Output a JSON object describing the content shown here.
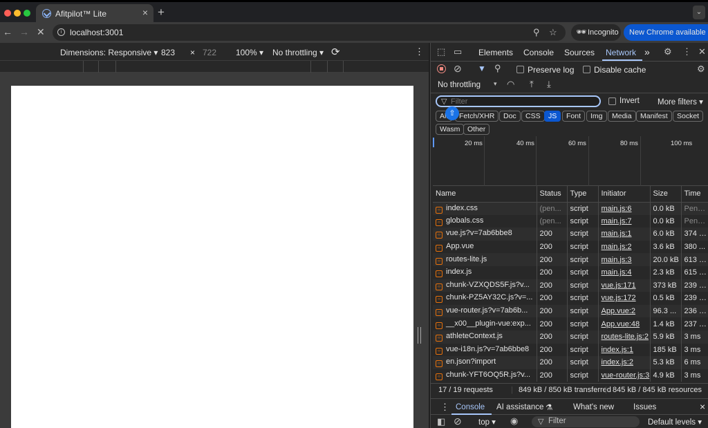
{
  "browser": {
    "tab_title": "Afitpilot™ Lite",
    "tab_close": "×",
    "new_tab": "+",
    "url": "localhost:3001",
    "incognito_label": "Incognito",
    "new_chrome_label": "New Chrome available",
    "traffic_colors": [
      "#ff5f57",
      "#febc2e",
      "#28c840"
    ]
  },
  "device_toolbar": {
    "dimensions_label": "Dimensions: Responsive ▾",
    "width": "823",
    "times": "×",
    "height": "722",
    "zoom": "100% ▾",
    "throttling": "No throttling ▾"
  },
  "devtools": {
    "tabs": [
      "Elements",
      "Console",
      "Sources",
      "Network"
    ],
    "active_tab": "Network",
    "more_tabs": "»",
    "preserve_log": "Preserve log",
    "disable_cache": "Disable cache",
    "throttling": "No throttling",
    "filter_placeholder": "Filter",
    "invert": "Invert",
    "more_filters": "More filters ▾",
    "type_filters": [
      "All",
      "Fetch/XHR",
      "Doc",
      "CSS",
      "JS",
      "Font",
      "Img",
      "Media",
      "Manifest",
      "Socket",
      "Wasm",
      "Other"
    ],
    "active_filter": "JS",
    "timeline_ticks": [
      "20 ms",
      "40 ms",
      "60 ms",
      "80 ms",
      "100 ms"
    ],
    "columns": [
      "Name",
      "Status",
      "Type",
      "Initiator",
      "Size",
      "Time"
    ],
    "requests": [
      {
        "name": "index.css",
        "status": "(pen...",
        "type": "script",
        "initiator": "main.js:6",
        "size": "0.0 kB",
        "time": "Pendi..."
      },
      {
        "name": "globals.css",
        "status": "(pen...",
        "type": "script",
        "initiator": "main.js:7",
        "size": "0.0 kB",
        "time": "Pendi..."
      },
      {
        "name": "vue.js?v=7ab6bbe8",
        "status": "200",
        "type": "script",
        "initiator": "main.js:1",
        "size": "6.0 kB",
        "time": "374 ms"
      },
      {
        "name": "App.vue",
        "status": "200",
        "type": "script",
        "initiator": "main.js:2",
        "size": "3.6 kB",
        "time": "380 ..."
      },
      {
        "name": "routes-lite.js",
        "status": "200",
        "type": "script",
        "initiator": "main.js:3",
        "size": "20.0 kB",
        "time": "613 ms"
      },
      {
        "name": "index.js",
        "status": "200",
        "type": "script",
        "initiator": "main.js:4",
        "size": "2.3 kB",
        "time": "615 ms"
      },
      {
        "name": "chunk-VZXQDS5F.js?v...",
        "status": "200",
        "type": "script",
        "initiator": "vue.js:171",
        "size": "373 kB",
        "time": "239 ms"
      },
      {
        "name": "chunk-PZ5AY32C.js?v=...",
        "status": "200",
        "type": "script",
        "initiator": "vue.js:172",
        "size": "0.5 kB",
        "time": "239 ms"
      },
      {
        "name": "vue-router.js?v=7ab6b...",
        "status": "200",
        "type": "script",
        "initiator": "App.vue:2",
        "size": "96.3 ...",
        "time": "236 ms"
      },
      {
        "name": "__x00__plugin-vue:exp...",
        "status": "200",
        "type": "script",
        "initiator": "App.vue:48",
        "size": "1.4 kB",
        "time": "237 ms"
      },
      {
        "name": "athleteContext.js",
        "status": "200",
        "type": "script",
        "initiator": "routes-lite.js:2",
        "size": "5.9 kB",
        "time": "3 ms"
      },
      {
        "name": "vue-i18n.js?v=7ab6bbe8",
        "status": "200",
        "type": "script",
        "initiator": "index.js:1",
        "size": "185 kB",
        "time": "3 ms"
      },
      {
        "name": "en.json?import",
        "status": "200",
        "type": "script",
        "initiator": "index.js:2",
        "size": "5.3 kB",
        "time": "6 ms"
      },
      {
        "name": "chunk-YFT6OQ5R.js?v...",
        "status": "200",
        "type": "script",
        "initiator": "vue-router.js:3",
        "size": "4.9 kB",
        "time": "3 ms"
      }
    ],
    "summary": {
      "requests": "17 / 19 requests",
      "transferred": "849 kB / 850 kB transferred",
      "resources": "845 kB / 845 kB resources"
    },
    "drawer_tabs": [
      "Console",
      "AI assistance",
      "What's new",
      "Issues"
    ],
    "drawer_close": "×",
    "drawer_context": "top ▾",
    "drawer_filter_placeholder": "Filter",
    "drawer_levels": "Default levels ▾"
  }
}
